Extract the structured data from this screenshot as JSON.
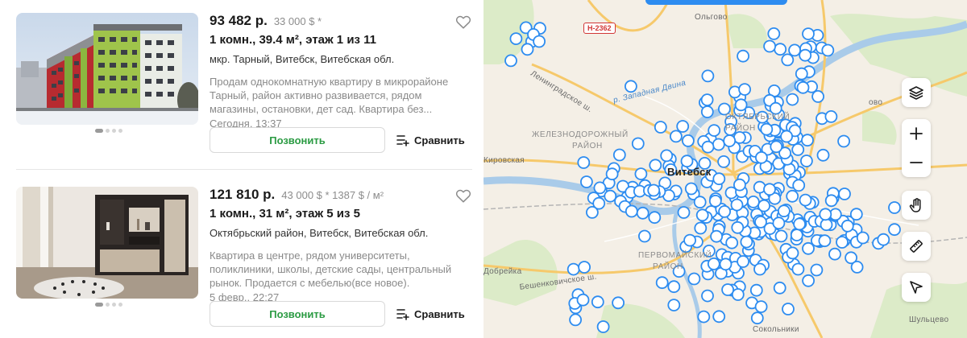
{
  "listings": [
    {
      "price": "93 482 р.",
      "price_usd": "33 000 $ *",
      "params": "1 комн., 39.4 м², этаж 1 из 11",
      "address": "мкр. Тарный, Витебск, Витебская обл.",
      "description": "Продам однокомнатную квартиру в микрорайоне Тарный, район активно развивается, рядом магазины, остановки, дет сад. Квартира без...",
      "date": "Сегодня, 13:37",
      "call_label": "Позвонить",
      "compare_label": "Сравнить",
      "photo": "new-apartment-building-photo"
    },
    {
      "price": "121 810 р.",
      "price_usd": "43 000 $ * 1387 $ / м²",
      "params": "1 комн., 31 м², этаж 5 из 5",
      "address": "Октябрьский район, Витебск, Витебская обл.",
      "description": "Квартира в центре, рядом университеты, поликлиники, школы, детские сады, центральный рынок. Продается с мебелью(все новое).",
      "date": "5 февр., 22:27",
      "call_label": "Позвонить",
      "compare_label": "Сравнить",
      "photo": "living-room-furniture-photo"
    }
  ],
  "map": {
    "road_badge": "Н-2362",
    "labels": {
      "olgovo": "Ольгово",
      "leningrad_hw": "Ленинградское ш.",
      "zapadnaya_dvina": "р. Западная Двина",
      "zheleznodorozhny": "ЖЕЛЕЗНОДОРОЖНЫЙ",
      "zheleznodorozhny_2": "РАЙОН",
      "oktyabrsky": "ОКТЯБРЬСКИЙ",
      "oktyabrsky_2": "РАЙОН",
      "kirovskaya": "Кировская",
      "city": "Витебск",
      "pervomaisky": "ПЕРВОМАЙСКИЙ",
      "pervomaisky_2": "РАЙОН",
      "dobreika": "Добрейка",
      "beshenkovichskoe": "Бешенковичское ш.",
      "shultsevo": "Шульцево",
      "sokolniki": "Сокольники",
      "nve": "ово"
    },
    "controls": [
      "layers-icon",
      "zoom-in-icon",
      "zoom-out-icon",
      "hand-icon",
      "ruler-icon",
      "navigate-arrow-icon"
    ],
    "marker_color": "#2d8cf0"
  }
}
